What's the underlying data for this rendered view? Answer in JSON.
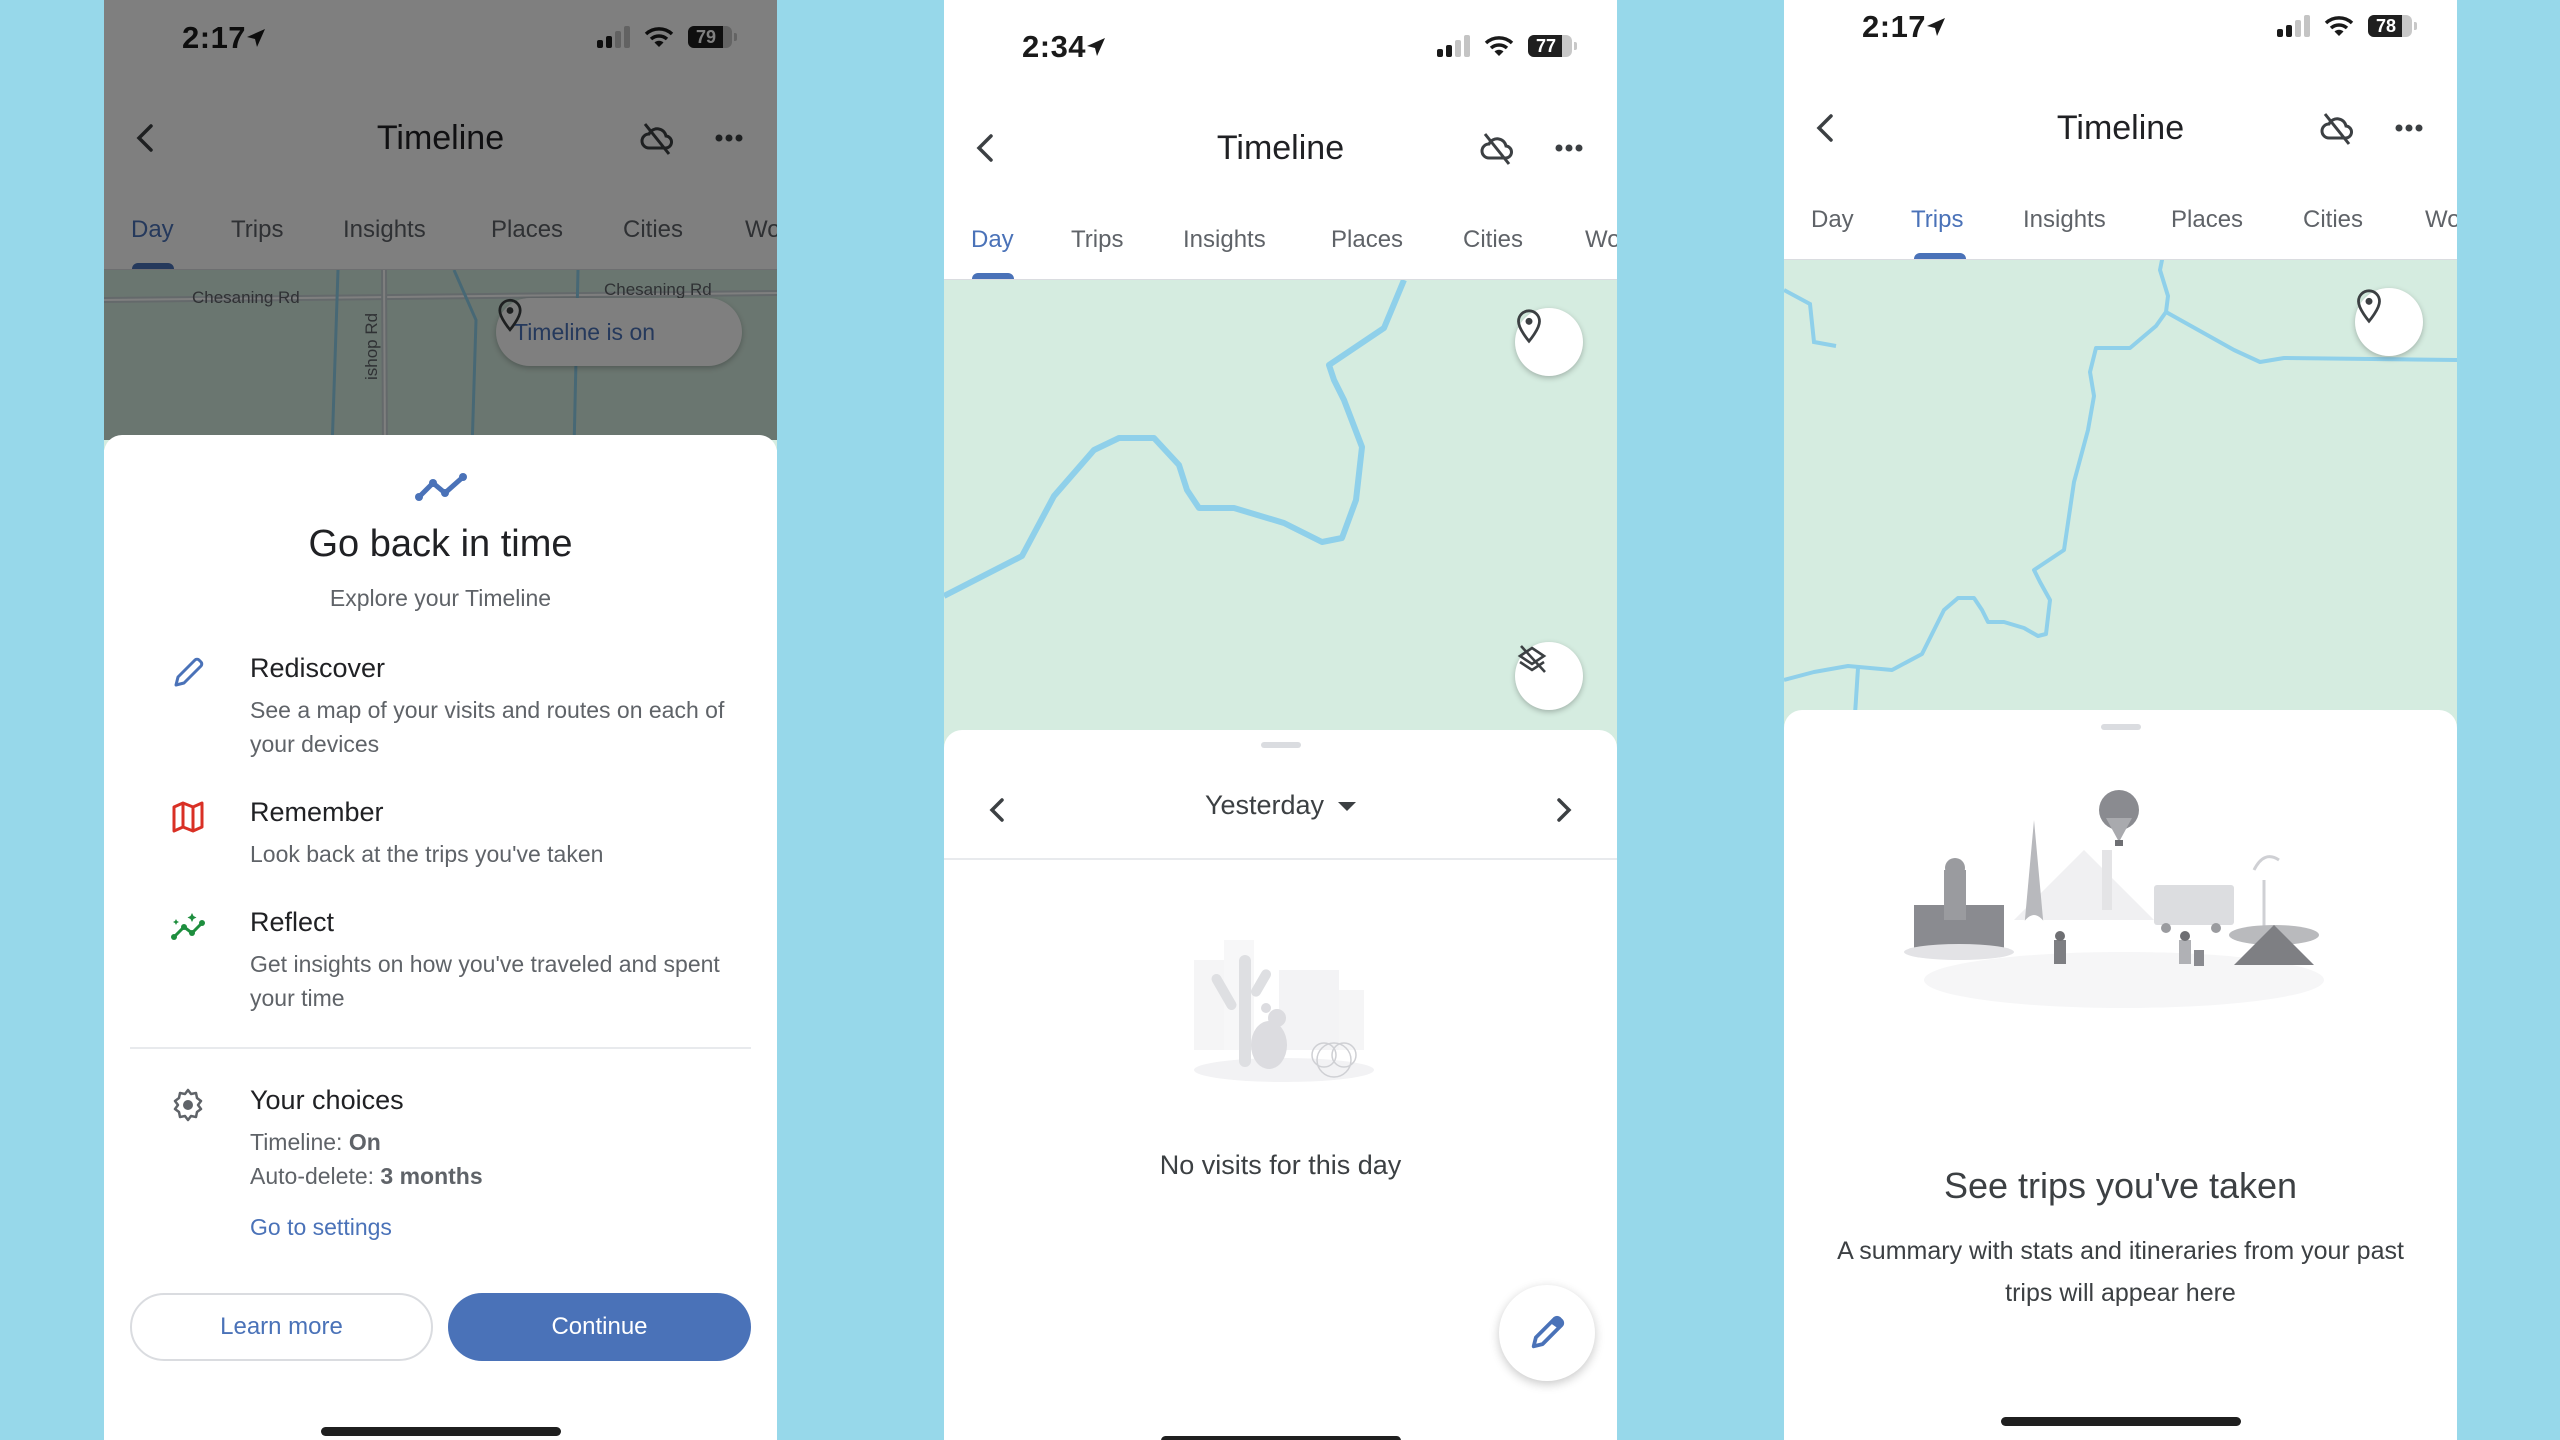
{
  "background_color": "#97d8ea",
  "accent_color": "#4a72b8",
  "panels": [
    {
      "status": {
        "time": "2:17",
        "battery": "79",
        "battery_level": 0.79,
        "signal_bars": 2
      },
      "appbar": {
        "title": "Timeline",
        "back_icon": "chevron-left-icon",
        "cloud_icon": "cloud-off-icon",
        "more_icon": "more-horizontal-icon"
      },
      "tabs": [
        {
          "label": "Day",
          "active": true
        },
        {
          "label": "Trips",
          "active": false
        },
        {
          "label": "Insights",
          "active": false
        },
        {
          "label": "Places",
          "active": false
        },
        {
          "label": "Cities",
          "active": false
        },
        {
          "label": "Wo",
          "active": false
        }
      ],
      "map": {
        "road_labels": [
          "Chesaning Rd",
          "Chesaning Rd",
          "ishop Rd"
        ],
        "chip_label": "Timeline is on"
      },
      "sheet": {
        "hero_icon": "timeline-line-icon",
        "title": "Go back in time",
        "subtitle": "Explore your Timeline",
        "features": [
          {
            "icon": "pencil-icon",
            "title": "Rediscover",
            "desc": "See a map of your visits and routes on each of your devices"
          },
          {
            "icon": "map-icon",
            "title": "Remember",
            "desc": "Look back at the trips you've taken"
          },
          {
            "icon": "insights-sparkle-icon",
            "title": "Reflect",
            "desc": "Get insights on how you've traveled and spent your time"
          }
        ],
        "choices": {
          "icon": "gear-icon",
          "title": "Your choices",
          "timeline_label": "Timeline: ",
          "timeline_value": "On",
          "autodelete_label": "Auto-delete: ",
          "autodelete_value": "3 months",
          "settings_link": "Go to settings"
        },
        "learn_more": "Learn more",
        "continue": "Continue"
      }
    },
    {
      "status": {
        "time": "2:34",
        "battery": "77",
        "battery_level": 0.77,
        "signal_bars": 2
      },
      "appbar": {
        "title": "Timeline"
      },
      "tabs": [
        {
          "label": "Day",
          "active": true
        },
        {
          "label": "Trips",
          "active": false
        },
        {
          "label": "Insights",
          "active": false
        },
        {
          "label": "Places",
          "active": false
        },
        {
          "label": "Cities",
          "active": false
        },
        {
          "label": "Wo",
          "active": false
        }
      ],
      "map": {
        "buttons": [
          "location-pin-icon",
          "layers-off-icon"
        ]
      },
      "sheet": {
        "date_label": "Yesterday",
        "empty_message": "No visits for this day",
        "fab_icon": "pencil-icon"
      }
    },
    {
      "status": {
        "time": "2:17",
        "battery": "78",
        "battery_level": 0.78,
        "signal_bars": 2
      },
      "appbar": {
        "title": "Timeline"
      },
      "tabs": [
        {
          "label": "Day",
          "active": false
        },
        {
          "label": "Trips",
          "active": true
        },
        {
          "label": "Insights",
          "active": false
        },
        {
          "label": "Places",
          "active": false
        },
        {
          "label": "Cities",
          "active": false
        },
        {
          "label": "Wo",
          "active": false
        }
      ],
      "map": {
        "buttons": [
          "location-pin-icon"
        ]
      },
      "sheet": {
        "title": "See trips you've taken",
        "desc": "A summary with stats and itineraries from your past trips will appear here"
      }
    }
  ]
}
